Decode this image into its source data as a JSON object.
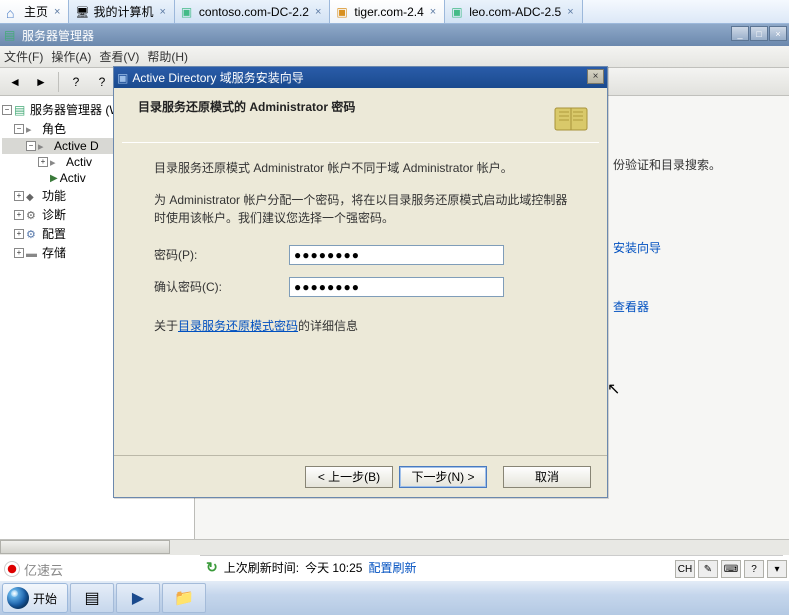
{
  "tabs": [
    {
      "label": "主页"
    },
    {
      "label": "我的计算机"
    },
    {
      "label": "contoso.com-DC-2.2"
    },
    {
      "label": "tiger.com-2.4"
    },
    {
      "label": "leo.com-ADC-2.5"
    }
  ],
  "window_title": "服务器管理器",
  "menu": {
    "file": "文件(F)",
    "action": "操作(A)",
    "view": "查看(V)",
    "help": "帮助(H)"
  },
  "tree": {
    "root": "服务器管理器 (W",
    "roles": "角色",
    "ad1": "Active D",
    "ad2": "Activ",
    "ad3": "Activ",
    "play_icon_alt": "▶",
    "features": "功能",
    "diagnostics": "诊断",
    "config": "配置",
    "storage": "存储"
  },
  "right": {
    "desc_tail": "份验证和目录搜索。",
    "wizard_link": "安装向导",
    "viewer_link": "查看器"
  },
  "dialog": {
    "title": "Active Directory 域服务安装向导",
    "heading": "目录服务还原模式的 Administrator 密码",
    "para1": "目录服务还原模式 Administrator 帐户不同于域 Administrator 帐户。",
    "para2": "为 Administrator 帐户分配一个密码，将在以目录服务还原模式启动此域控制器时使用该帐户。我们建议您选择一个强密码。",
    "pwd_label": "密码(P):",
    "confirm_label": "确认密码(C):",
    "pwd_value": "●●●●●●●●",
    "confirm_value": "●●●●●●●●",
    "link_prefix": "关于",
    "link_text": "目录服务还原模式密码",
    "link_suffix": "的详细信息",
    "back": "< 上一步(B)",
    "next": "下一步(N) >",
    "cancel": "取消"
  },
  "status": {
    "label": "上次刷新时间:",
    "time": "今天 10:25",
    "action": "配置刷新"
  },
  "lang": {
    "ch": "CH"
  },
  "watermark": "亿速云",
  "start": "开始"
}
